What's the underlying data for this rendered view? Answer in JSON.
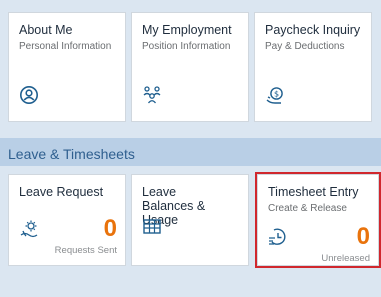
{
  "tiles_top": [
    {
      "title": "About Me",
      "subtitle": "Personal Information",
      "icon": "person-circle-icon"
    },
    {
      "title": "My Employment",
      "subtitle": "Position Information",
      "icon": "group-icon"
    },
    {
      "title": "Paycheck Inquiry",
      "subtitle": "Pay & Deductions",
      "icon": "money-hand-icon"
    }
  ],
  "group": {
    "title": "Leave & Timesheets"
  },
  "tiles_bottom": [
    {
      "title": "Leave Request",
      "subtitle": "",
      "icon": "beach-sun-icon",
      "kpi": "0",
      "footer": "Requests Sent"
    },
    {
      "title": "Leave Balances & Usage",
      "subtitle": "",
      "icon": "table-icon"
    },
    {
      "title": "Timesheet Entry",
      "subtitle": "Create & Release",
      "icon": "time-entry-icon",
      "kpi": "0",
      "footer": "Unreleased"
    }
  ],
  "colors": {
    "accent": "#e9730c",
    "icon_blue": "#1f5f8f",
    "group_bar": "#b9cfe6",
    "selection": "#d0272d"
  }
}
